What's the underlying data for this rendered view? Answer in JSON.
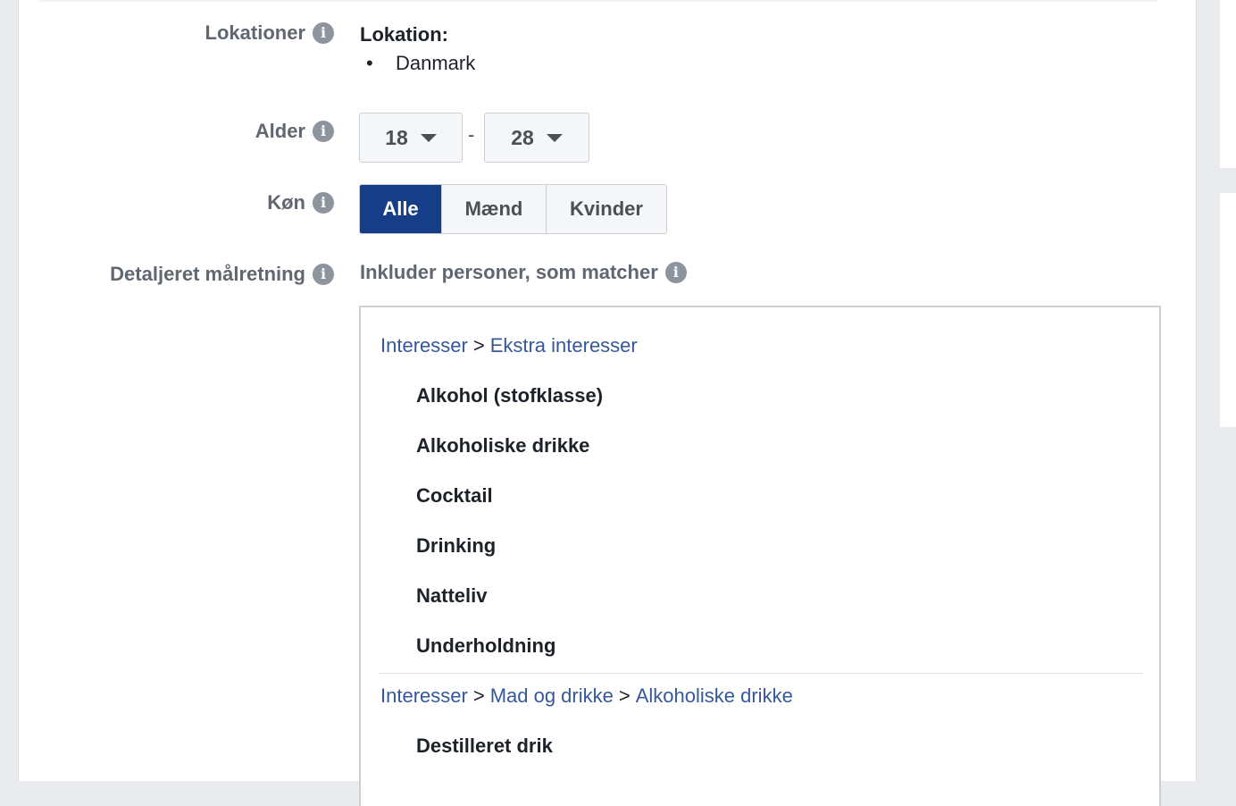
{
  "location": {
    "label": "Lokationer",
    "heading": "Lokation:",
    "items": [
      "Danmark"
    ]
  },
  "age": {
    "label": "Alder",
    "from": "18",
    "separator": "-",
    "to": "28"
  },
  "gender": {
    "label": "Køn",
    "options": [
      "Alle",
      "Mænd",
      "Kvinder"
    ],
    "selected": "Alle"
  },
  "detailed_targeting": {
    "label": "Detaljeret målretning",
    "include_label": "Inkluder personer, som matcher",
    "groups": [
      {
        "breadcrumb": [
          "Interesser",
          "Ekstra interesser"
        ],
        "items": [
          "Alkohol (stofklasse)",
          "Alkoholiske drikke",
          "Cocktail",
          "Drinking",
          "Natteliv",
          "Underholdning"
        ]
      },
      {
        "breadcrumb": [
          "Interesser",
          "Mad og drikke",
          "Alkoholiske drikke"
        ],
        "items": [
          "Destilleret drik"
        ]
      }
    ],
    "breadcrumb_separator": ">"
  },
  "colors": {
    "accent_selected": "#163d87",
    "link": "#365899",
    "label_gray": "#606770",
    "info_icon": "#8d949e"
  }
}
